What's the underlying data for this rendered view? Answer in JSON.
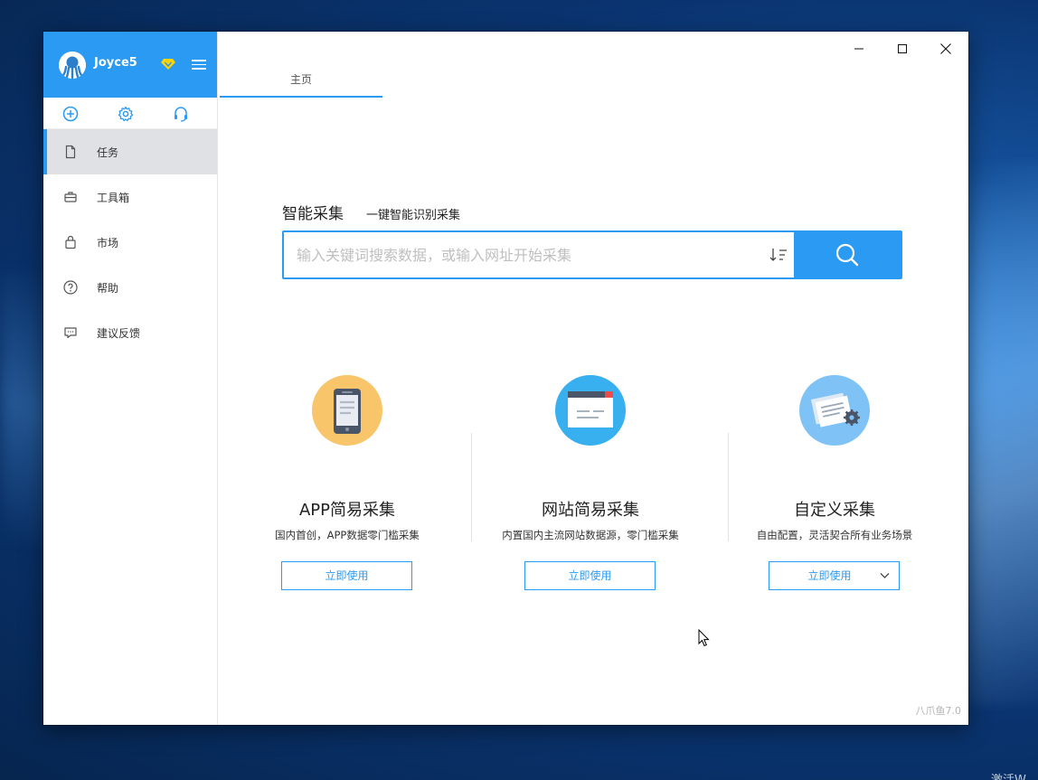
{
  "app": {
    "version": "八爪鱼7.0"
  },
  "user": {
    "name": "Joyce5"
  },
  "colors": {
    "accent": "#2b9af3",
    "sidebar_active": "#dfe1e5",
    "app_card_bg": "#f9c56a",
    "web_card_bg": "#38b0f0",
    "custom_card_bg": "#7fc2f5"
  },
  "sidebar": {
    "quick_actions": [
      {
        "icon": "add-circle-icon"
      },
      {
        "icon": "gear-icon"
      },
      {
        "icon": "headset-icon"
      }
    ],
    "items": [
      {
        "label": "任务",
        "icon": "file-icon",
        "active": true
      },
      {
        "label": "工具箱",
        "icon": "toolbox-icon",
        "active": false
      },
      {
        "label": "市场",
        "icon": "shopping-bag-icon",
        "active": false
      },
      {
        "label": "帮助",
        "icon": "help-icon",
        "active": false
      },
      {
        "label": "建议反馈",
        "icon": "feedback-icon",
        "active": false
      }
    ]
  },
  "tabs": [
    {
      "label": "主页"
    }
  ],
  "smart": {
    "title": "智能采集",
    "subtitle": "一键智能识别采集",
    "placeholder": "输入关键词搜索数据，或输入网址开始采集"
  },
  "cards": [
    {
      "title": "APP简易采集",
      "desc": "国内首创，APP数据零门槛采集",
      "button": "立即使用",
      "icon": "phone-icon"
    },
    {
      "title": "网站简易采集",
      "desc": "内置国内主流网站数据源，零门槛采集",
      "button": "立即使用",
      "icon": "browser-window-icon"
    },
    {
      "title": "自定义采集",
      "desc": "自由配置，灵活契合所有业务场景",
      "button": "立即使用",
      "icon": "documents-gear-icon"
    }
  ],
  "desktop": {
    "watermark": "激活W"
  }
}
